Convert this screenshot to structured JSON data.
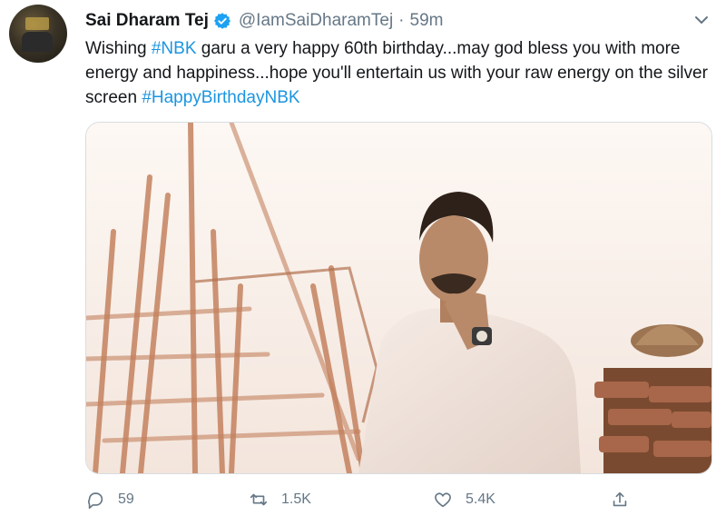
{
  "tweet": {
    "author_name": "Sai Dharam Tej",
    "handle": "@IamSaiDharamTej",
    "separator": "·",
    "time": "59m",
    "text_parts": [
      {
        "text": "Wishing ",
        "tag": false
      },
      {
        "text": "#NBK",
        "tag": true
      },
      {
        "text": " garu a very happy 60th birthday...may god bless you with more energy and happiness...hope you'll entertain us with your raw energy on the silver screen ",
        "tag": false
      },
      {
        "text": "#HappyBirthdayNBK",
        "tag": true
      }
    ],
    "replies": "59",
    "retweets": "1.5K",
    "likes": "5.4K"
  },
  "colors": {
    "link": "#1b95e0",
    "muted": "#657786",
    "verified": "#1da1f2"
  },
  "icons": [
    "verified-badge-icon",
    "chevron-down-icon",
    "reply-icon",
    "retweet-icon",
    "like-icon",
    "share-icon"
  ]
}
